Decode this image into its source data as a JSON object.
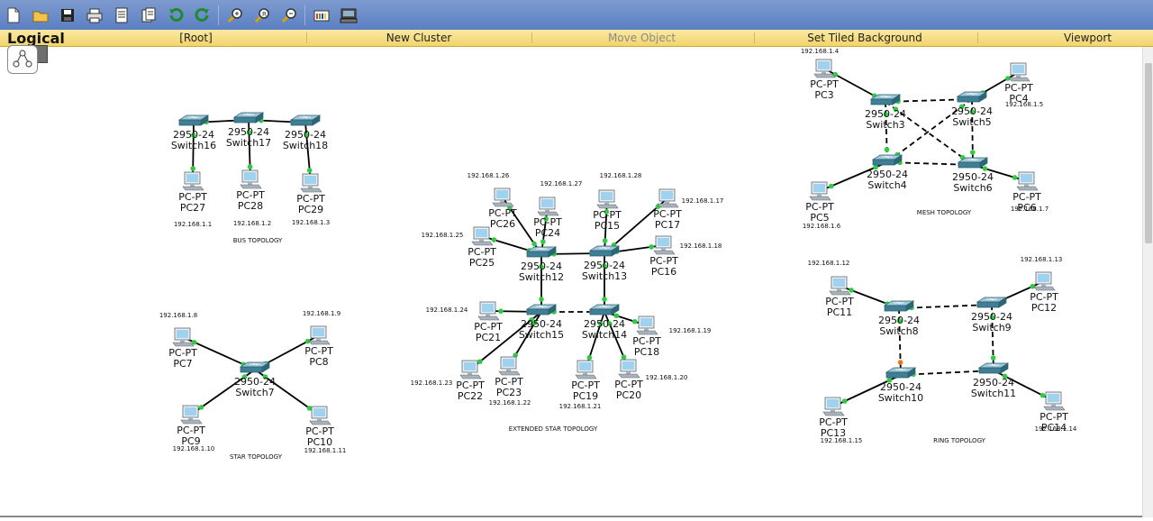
{
  "toolbar": {
    "buttons": [
      {
        "name": "new-file-icon"
      },
      {
        "name": "open-folder-icon"
      },
      {
        "name": "save-icon"
      },
      {
        "name": "print-icon"
      },
      {
        "name": "activity-wizard-icon"
      },
      {
        "name": "copy-icon"
      },
      {
        "name": "undo-icon"
      },
      {
        "name": "redo-icon"
      },
      {
        "name": "zoom-in-icon"
      },
      {
        "name": "zoom-reset-icon"
      },
      {
        "name": "zoom-out-icon"
      },
      {
        "name": "palette-icon"
      },
      {
        "name": "custom-device-icon"
      }
    ]
  },
  "navbar": {
    "logical_label": "Logical",
    "root_label": "[Root]",
    "new_cluster_label": "New Cluster",
    "move_object_label": "Move Object",
    "set_tiled_background_label": "Set Tiled Background",
    "viewport_label": "Viewport"
  },
  "colors": {
    "link": "#000000",
    "port_up": "#2ecc40",
    "port_down": "#e8761c",
    "switch_top": "#9fc7d6",
    "switch_side": "#3f7f96",
    "pc_screen": "#9ed2ee",
    "pc_body": "#a9b3bb"
  },
  "switches": [
    {
      "id": "sw16",
      "model": "2950-24",
      "name": "Switch16"
    },
    {
      "id": "sw17",
      "model": "2950-24",
      "name": "Switch17"
    },
    {
      "id": "sw18",
      "model": "2950-24",
      "name": "Switch18"
    },
    {
      "id": "sw7",
      "model": "2950-24",
      "name": "Switch7"
    },
    {
      "id": "sw12",
      "model": "2950-24",
      "name": "Switch12"
    },
    {
      "id": "sw13",
      "model": "2950-24",
      "name": "Switch13"
    },
    {
      "id": "sw15",
      "model": "2950-24",
      "name": "Switch15"
    },
    {
      "id": "sw14",
      "model": "2950-24",
      "name": "Switch14"
    },
    {
      "id": "sw3",
      "model": "2950-24",
      "name": "Switch3"
    },
    {
      "id": "sw5",
      "model": "2950-24",
      "name": "Switch5"
    },
    {
      "id": "sw4",
      "model": "2950-24",
      "name": "Switch4"
    },
    {
      "id": "sw6",
      "model": "2950-24",
      "name": "Switch6"
    },
    {
      "id": "sw8",
      "model": "2950-24",
      "name": "Switch8"
    },
    {
      "id": "sw9",
      "model": "2950-24",
      "name": "Switch9"
    },
    {
      "id": "sw10",
      "model": "2950-24",
      "name": "Switch10"
    },
    {
      "id": "sw11",
      "model": "2950-24",
      "name": "Switch11"
    }
  ],
  "pcs": [
    {
      "id": "pc27",
      "model": "PC-PT",
      "name": "PC27",
      "ip": "192.168.1.1"
    },
    {
      "id": "pc28",
      "model": "PC-PT",
      "name": "PC28",
      "ip": "192.168.1.2"
    },
    {
      "id": "pc29",
      "model": "PC-PT",
      "name": "PC29",
      "ip": "192.168.1.3"
    },
    {
      "id": "pc7",
      "model": "PC-PT",
      "name": "PC7",
      "ip": "192.168.1.8"
    },
    {
      "id": "pc8",
      "model": "PC-PT",
      "name": "PC8",
      "ip": "192.168.1.9"
    },
    {
      "id": "pc9",
      "model": "PC-PT",
      "name": "PC9",
      "ip": "192.168.1.10"
    },
    {
      "id": "pc10",
      "model": "PC-PT",
      "name": "PC10",
      "ip": "192.168.1.11"
    },
    {
      "id": "pc26",
      "model": "PC-PT",
      "name": "PC26",
      "ip": "192.168.1.26"
    },
    {
      "id": "pc24",
      "model": "PC-PT",
      "name": "PC24",
      "ip": "192.168.1.27"
    },
    {
      "id": "pc15",
      "model": "PC-PT",
      "name": "PC15",
      "ip": "192.168.1.28"
    },
    {
      "id": "pc17",
      "model": "PC-PT",
      "name": "PC17",
      "ip": "192.168.1.17"
    },
    {
      "id": "pc25",
      "model": "PC-PT",
      "name": "PC25",
      "ip": "192.168.1.25"
    },
    {
      "id": "pc16",
      "model": "PC-PT",
      "name": "PC16",
      "ip": "192.168.1.18"
    },
    {
      "id": "pc21",
      "model": "PC-PT",
      "name": "PC21",
      "ip": "192.168.1.24"
    },
    {
      "id": "pc18",
      "model": "PC-PT",
      "name": "PC18",
      "ip": "192.168.1.19"
    },
    {
      "id": "pc22",
      "model": "PC-PT",
      "name": "PC22",
      "ip": "192.168.1.23"
    },
    {
      "id": "pc23",
      "model": "PC-PT",
      "name": "PC23",
      "ip": "192.168.1.22"
    },
    {
      "id": "pc19",
      "model": "PC-PT",
      "name": "PC19",
      "ip": "192.168.1.21"
    },
    {
      "id": "pc20",
      "model": "PC-PT",
      "name": "PC20",
      "ip": "192.168.1.20"
    },
    {
      "id": "pc3",
      "model": "PC-PT",
      "name": "PC3",
      "ip": "192.168.1.4"
    },
    {
      "id": "pc4",
      "model": "PC-PT",
      "name": "PC4",
      "ip": "192.168.1.5"
    },
    {
      "id": "pc5",
      "model": "PC-PT",
      "name": "PC5",
      "ip": "192.168.1.6"
    },
    {
      "id": "pc6",
      "model": "PC-PT",
      "name": "PC6",
      "ip": "192.168.1.7"
    },
    {
      "id": "pc11",
      "model": "PC-PT",
      "name": "PC11",
      "ip": "192.168.1.12"
    },
    {
      "id": "pc12",
      "model": "PC-PT",
      "name": "PC12",
      "ip": "192.168.1.13"
    },
    {
      "id": "pc13",
      "model": "PC-PT",
      "name": "PC13",
      "ip": "192.168.1.15"
    },
    {
      "id": "pc14",
      "model": "PC-PT",
      "name": "PC14",
      "ip": "192.168.1.14"
    }
  ],
  "topology_labels": [
    {
      "id": "bus",
      "text": "BUS TOPOLOGY"
    },
    {
      "id": "star",
      "text": "STAR TOPOLOGY"
    },
    {
      "id": "ext",
      "text": "EXTENDED STAR TOPOLOGY"
    },
    {
      "id": "mesh",
      "text": "MESH TOPOLOGY"
    },
    {
      "id": "ring",
      "text": "RING TOPOLOGY"
    }
  ],
  "links": [
    {
      "a": "sw16",
      "b": "sw17",
      "style": "solid"
    },
    {
      "a": "sw17",
      "b": "sw18",
      "style": "solid"
    },
    {
      "a": "sw16",
      "b": "pc27",
      "style": "solid"
    },
    {
      "a": "sw17",
      "b": "pc28",
      "style": "solid"
    },
    {
      "a": "sw18",
      "b": "pc29",
      "style": "solid"
    },
    {
      "a": "sw7",
      "b": "pc7",
      "style": "solid"
    },
    {
      "a": "sw7",
      "b": "pc8",
      "style": "solid"
    },
    {
      "a": "sw7",
      "b": "pc9",
      "style": "solid"
    },
    {
      "a": "sw7",
      "b": "pc10",
      "style": "solid"
    },
    {
      "a": "sw12",
      "b": "sw13",
      "style": "solid"
    },
    {
      "a": "sw12",
      "b": "sw15",
      "style": "solid"
    },
    {
      "a": "sw13",
      "b": "sw14",
      "style": "solid"
    },
    {
      "a": "sw15",
      "b": "sw14",
      "style": "dashed"
    },
    {
      "a": "sw12",
      "b": "pc26",
      "style": "solid"
    },
    {
      "a": "sw12",
      "b": "pc24",
      "style": "solid"
    },
    {
      "a": "sw12",
      "b": "pc25",
      "style": "solid"
    },
    {
      "a": "sw13",
      "b": "pc15",
      "style": "solid"
    },
    {
      "a": "sw13",
      "b": "pc17",
      "style": "solid"
    },
    {
      "a": "sw13",
      "b": "pc16",
      "style": "solid"
    },
    {
      "a": "sw15",
      "b": "pc21",
      "style": "solid"
    },
    {
      "a": "sw15",
      "b": "pc22",
      "style": "solid"
    },
    {
      "a": "sw15",
      "b": "pc23",
      "style": "solid"
    },
    {
      "a": "sw14",
      "b": "pc18",
      "style": "solid"
    },
    {
      "a": "sw14",
      "b": "pc19",
      "style": "solid"
    },
    {
      "a": "sw14",
      "b": "pc20",
      "style": "solid"
    },
    {
      "a": "sw3",
      "b": "sw5",
      "style": "dashed"
    },
    {
      "a": "sw3",
      "b": "sw4",
      "style": "dashed"
    },
    {
      "a": "sw3",
      "b": "sw6",
      "style": "dashed"
    },
    {
      "a": "sw5",
      "b": "sw4",
      "style": "dashed"
    },
    {
      "a": "sw5",
      "b": "sw6",
      "style": "dashed"
    },
    {
      "a": "sw4",
      "b": "sw6",
      "style": "dashed"
    },
    {
      "a": "sw3",
      "b": "pc3",
      "style": "solid"
    },
    {
      "a": "sw5",
      "b": "pc4",
      "style": "solid"
    },
    {
      "a": "sw4",
      "b": "pc5",
      "style": "solid"
    },
    {
      "a": "sw6",
      "b": "pc6",
      "style": "solid"
    },
    {
      "a": "sw8",
      "b": "sw9",
      "style": "dashed"
    },
    {
      "a": "sw8",
      "b": "sw10",
      "style": "dashed"
    },
    {
      "a": "sw9",
      "b": "sw11",
      "style": "dashed"
    },
    {
      "a": "sw10",
      "b": "sw11",
      "style": "dashed"
    },
    {
      "a": "sw8",
      "b": "pc11",
      "style": "solid"
    },
    {
      "a": "sw9",
      "b": "pc12",
      "style": "solid"
    },
    {
      "a": "sw10",
      "b": "pc13",
      "style": "solid"
    },
    {
      "a": "sw11",
      "b": "pc14",
      "style": "solid"
    }
  ]
}
